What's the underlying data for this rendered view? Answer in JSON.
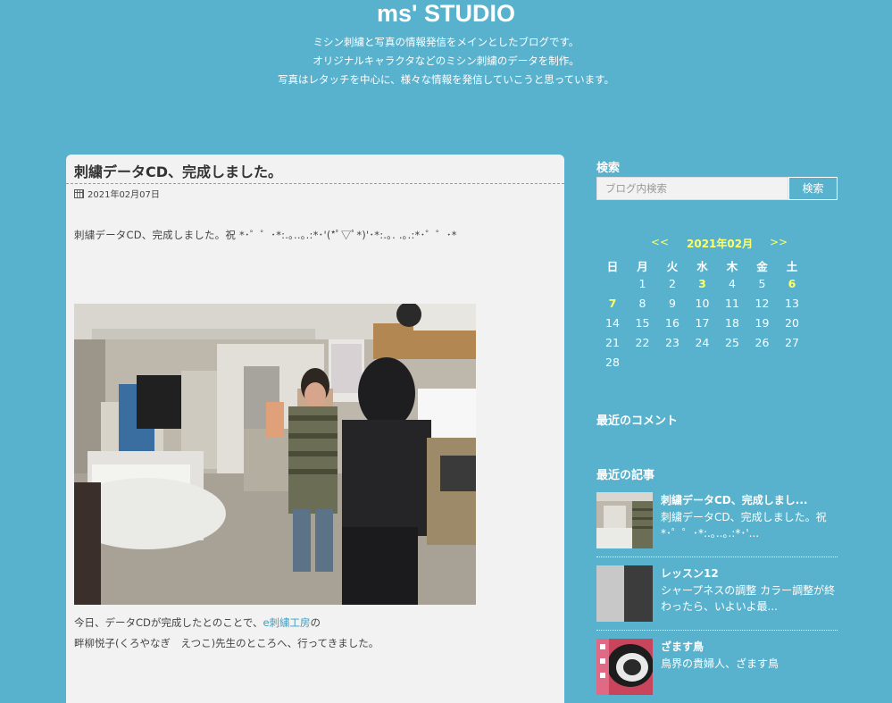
{
  "header": {
    "title": "ms' STUDIO",
    "description": [
      "ミシン刺繍と写真の情報発信をメインとしたブログです。",
      "オリジナルキャラクタなどのミシン刺繍のデータを制作。",
      "写真はレタッチを中心に、様々な情報を発信していこうと思っています。"
    ]
  },
  "article": {
    "title": "刺繍データCD、完成しました。",
    "date": "2021年02月07日",
    "lead": "刺繍データCD、完成しました。祝 *･゜゜･*:.｡..｡.:*･'(*ﾟ▽ﾟ*)'･*:.｡. .｡.:*･゜゜･*",
    "body_pre": "今日、データCDが完成したとのことで、",
    "body_link": "e刺繍工房",
    "body_post": "の",
    "body_line2": "畔柳悦子(くろやなぎ　えつこ)先生のところへ、行ってきました。"
  },
  "sidebar": {
    "search": {
      "heading": "検索",
      "placeholder": "ブログ内検索",
      "button": "検索"
    },
    "calendar": {
      "prev": "<<",
      "month": "2021年02月",
      "next": ">>",
      "weekdays": [
        "日",
        "月",
        "火",
        "水",
        "木",
        "金",
        "土"
      ],
      "start_offset": 1,
      "days_in_month": 28,
      "highlighted_days": [
        3,
        6,
        7
      ]
    },
    "recent_comments": {
      "heading": "最近のコメント"
    },
    "recent_posts": {
      "heading": "最近の記事",
      "items": [
        {
          "title": "刺繍データCD、完成しまし...",
          "desc": "刺繍データCD、完成しました。祝 *･゜゜･*:.｡..｡.:*･'..."
        },
        {
          "title": "レッスン12",
          "desc": "シャープネスの調整 カラー調整が終わったら、いよいよ最..."
        },
        {
          "title": "ざます鳥",
          "desc": "鳥界の貴婦人、ざます鳥"
        }
      ]
    }
  }
}
